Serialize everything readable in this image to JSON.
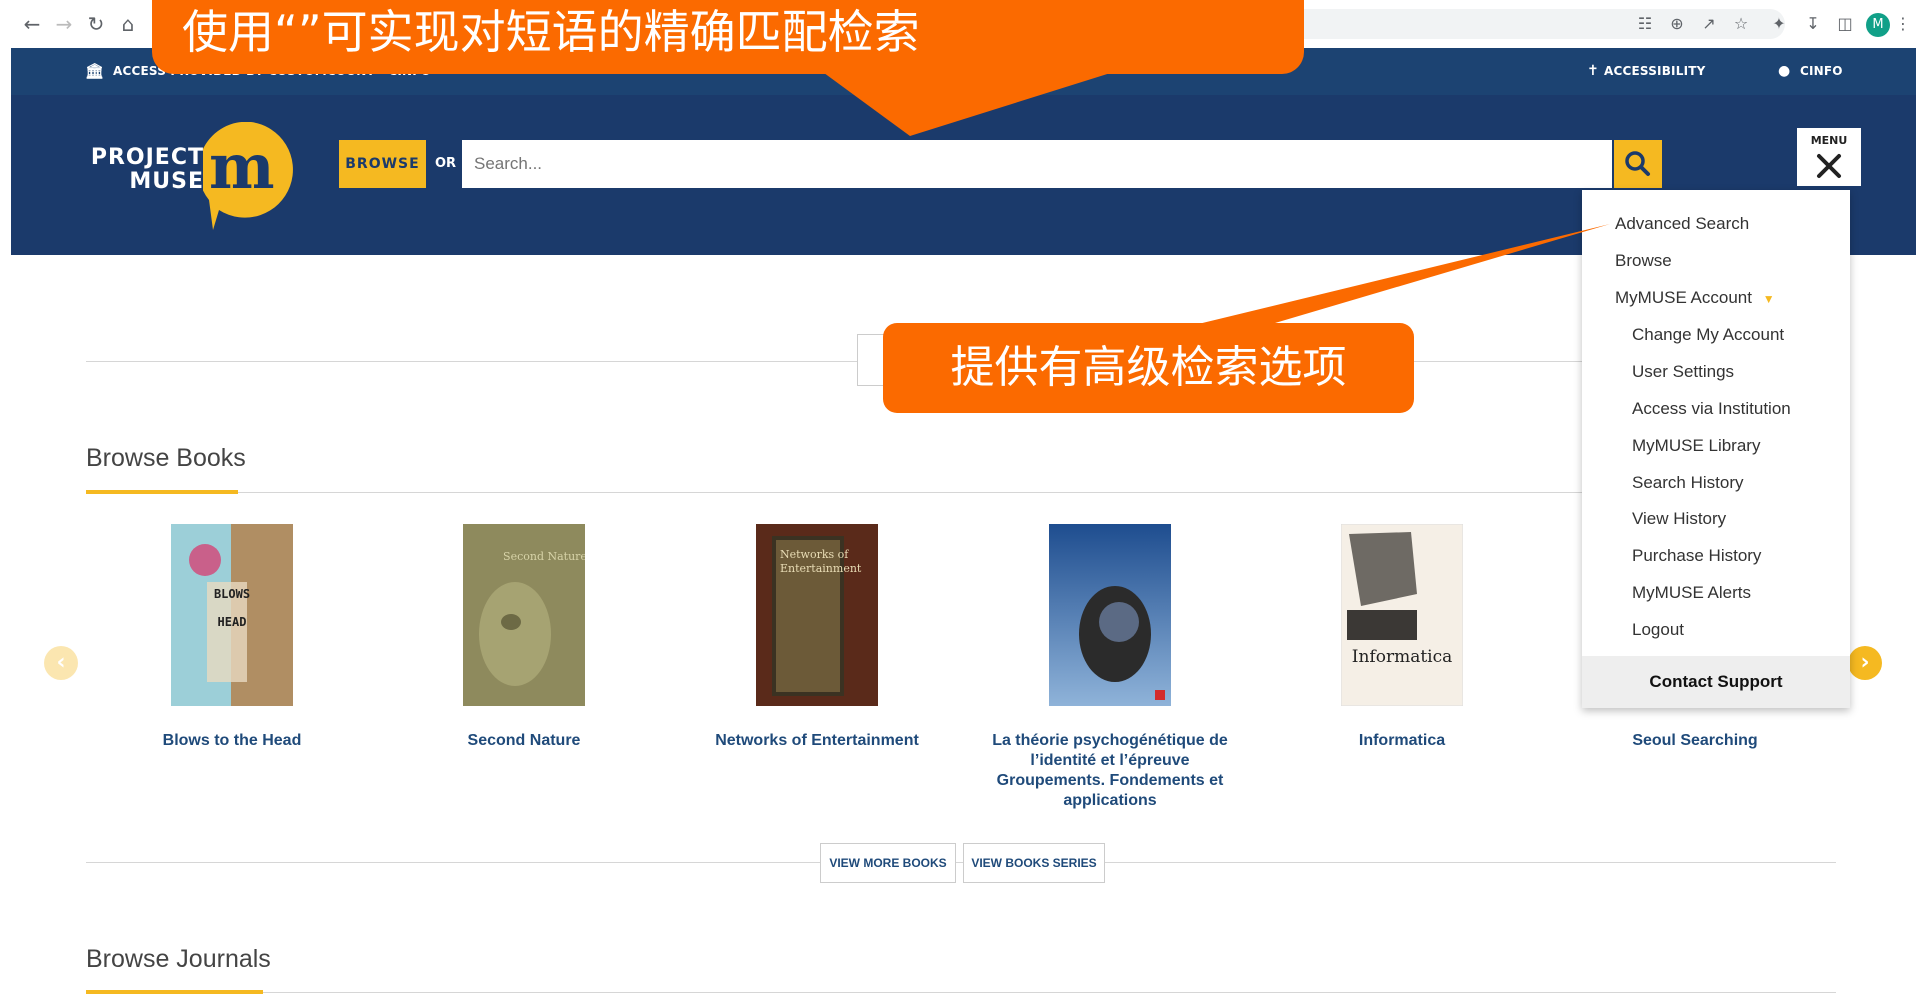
{
  "colors": {
    "navy": "#1b3a6b",
    "bar": "#1c4372",
    "gold": "#f5b921",
    "callout": "#fb6a00",
    "link": "#1f4a7a"
  },
  "browser": {
    "profile_initial": "M"
  },
  "access_bar": {
    "access_text": "ACCESS PROVIDED BY CUSTOMCOUNT · CINFO",
    "accessibility": "ACCESSIBILITY",
    "user": "CINFO"
  },
  "header": {
    "logo_line1": "PROJECT",
    "logo_line2": "MUSE",
    "browse_label": "BROWSE",
    "or_label": "OR",
    "search_placeholder": "Search...",
    "menu_label": "MENU"
  },
  "callouts": {
    "top": "使用“”可实现对短语的精确匹配检索",
    "middle": "提供有高级检索选项"
  },
  "sections": {
    "books_title": "Browse Books",
    "journals_title": "Browse Journals",
    "view_more_books": "VIEW MORE BOOKS",
    "view_books_series": "VIEW BOOKS SERIES"
  },
  "books": [
    {
      "title": "Blows to the Head",
      "cover_text": "BLOWS TO THE HEAD"
    },
    {
      "title": "Second Nature",
      "cover_text": "Second Nature"
    },
    {
      "title": "Networks of Entertainment",
      "cover_text": "Networks of Entertainment"
    },
    {
      "title": "La théorie psychogénétique de l’identité et l’épreuve Groupements. Fondements et applications",
      "cover_text": ""
    },
    {
      "title": "Informatica",
      "cover_text": "Informatica"
    },
    {
      "title": "Seoul Searching",
      "cover_text": ""
    }
  ],
  "menu": {
    "items": [
      "Advanced Search",
      "Browse",
      "MyMUSE Account",
      "Change My Account",
      "User Settings",
      "Access via Institution",
      "MyMUSE Library",
      "Search History",
      "View History",
      "Purchase History",
      "MyMUSE Alerts",
      "Logout"
    ],
    "support": "Contact Support"
  }
}
